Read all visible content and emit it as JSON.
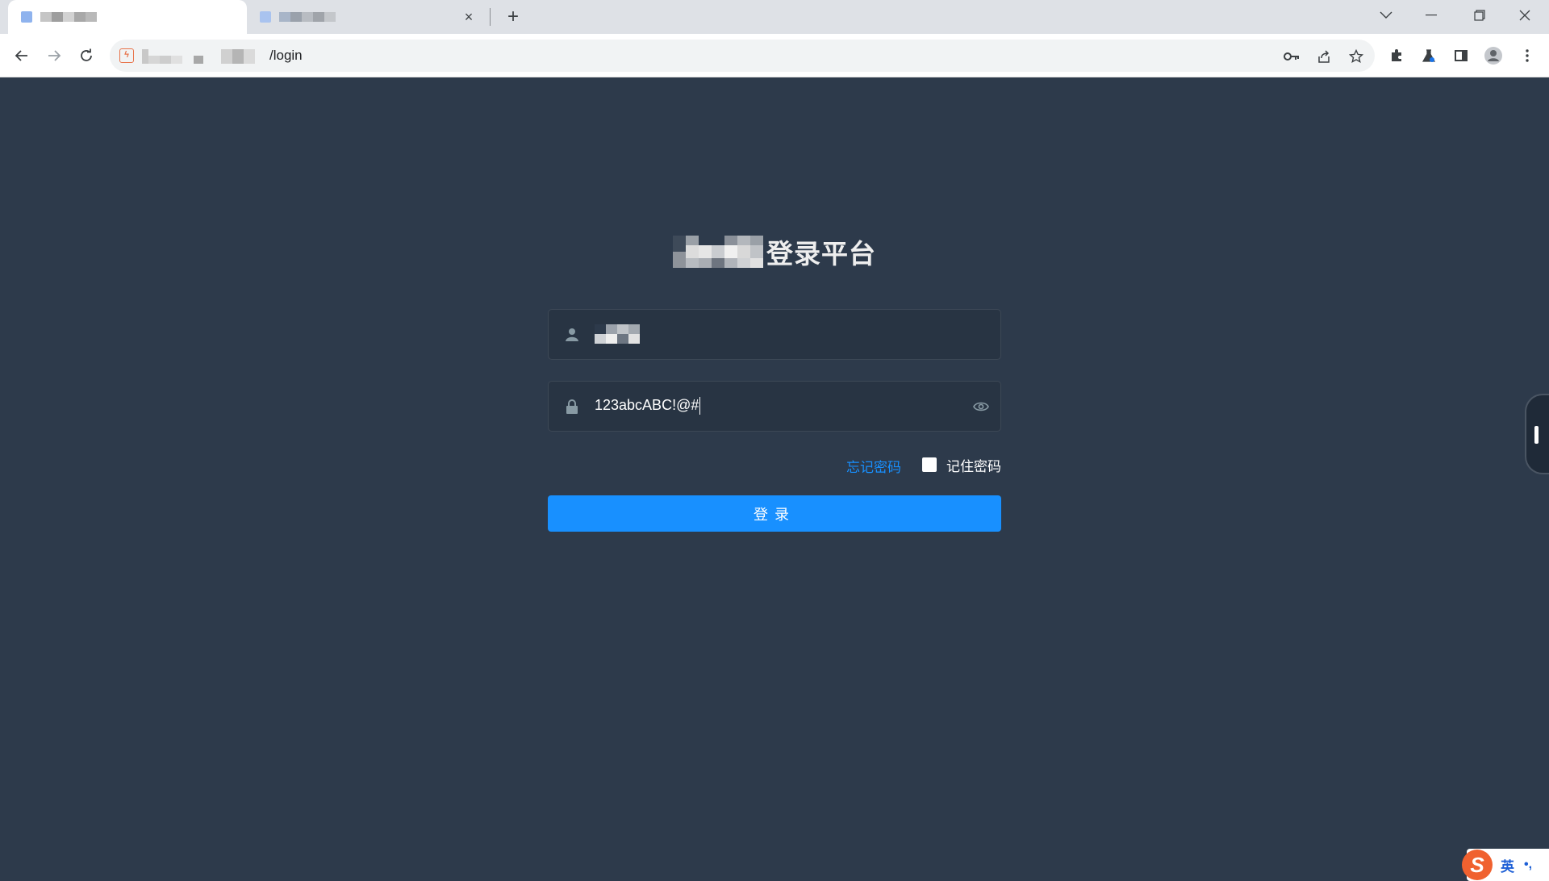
{
  "browser": {
    "tabs": [
      {
        "label": ""
      },
      {
        "label": ""
      }
    ],
    "tab_close_glyph": "×",
    "new_tab_glyph": "+",
    "url_path": "/login",
    "window_controls": {
      "dropdown": "⌵",
      "minimize": "—",
      "restore": "❐",
      "close": "✕"
    }
  },
  "login": {
    "title": "登录平台",
    "username": {
      "value": "",
      "icon": "user-icon"
    },
    "password": {
      "value": "123abcABC!@#",
      "icon": "lock-icon"
    },
    "forgot_password": "忘记密码",
    "remember_password": "记住密码",
    "remember_checked": false,
    "submit_label": "登录"
  },
  "ime": {
    "lang": "英",
    "punct": "•,"
  },
  "colors": {
    "page_bg": "#2d3a4b",
    "field_bg": "#283443",
    "primary": "#1890ff",
    "icon": "#889aa4"
  }
}
